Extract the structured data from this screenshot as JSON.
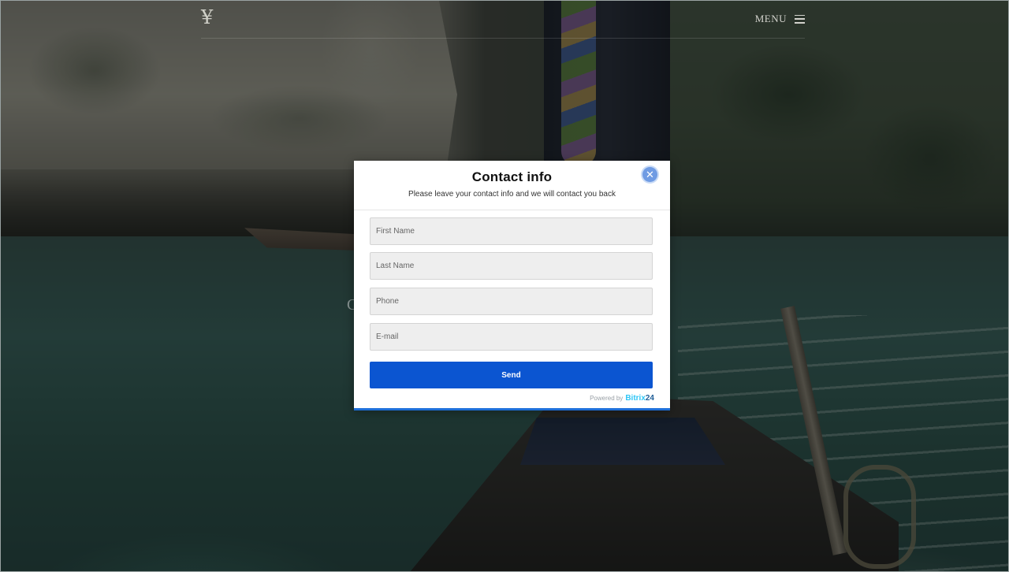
{
  "header": {
    "logo_glyph": "¥",
    "menu_label": "MENU"
  },
  "hero": {
    "partial_glyph": "C"
  },
  "modal": {
    "title": "Contact info",
    "subtitle": "Please leave your contact info and we will contact you back",
    "close_glyph": "✕",
    "fields": [
      {
        "placeholder": "First Name",
        "value": ""
      },
      {
        "placeholder": "Last Name",
        "value": ""
      },
      {
        "placeholder": "Phone",
        "value": ""
      },
      {
        "placeholder": "E-mail",
        "value": ""
      }
    ],
    "send_label": "Send",
    "powered_by": "Powered by",
    "brand_name": "Bitrix",
    "brand_number": "24"
  },
  "colors": {
    "accent": "#0b55d1",
    "close_button": "#6f9be3",
    "brand": "#2fc6f6",
    "overlay": "#0a0e0e"
  },
  "icons": {
    "close": "close-icon",
    "menu": "hamburger-menu-icon",
    "logo": "logo-icon"
  }
}
